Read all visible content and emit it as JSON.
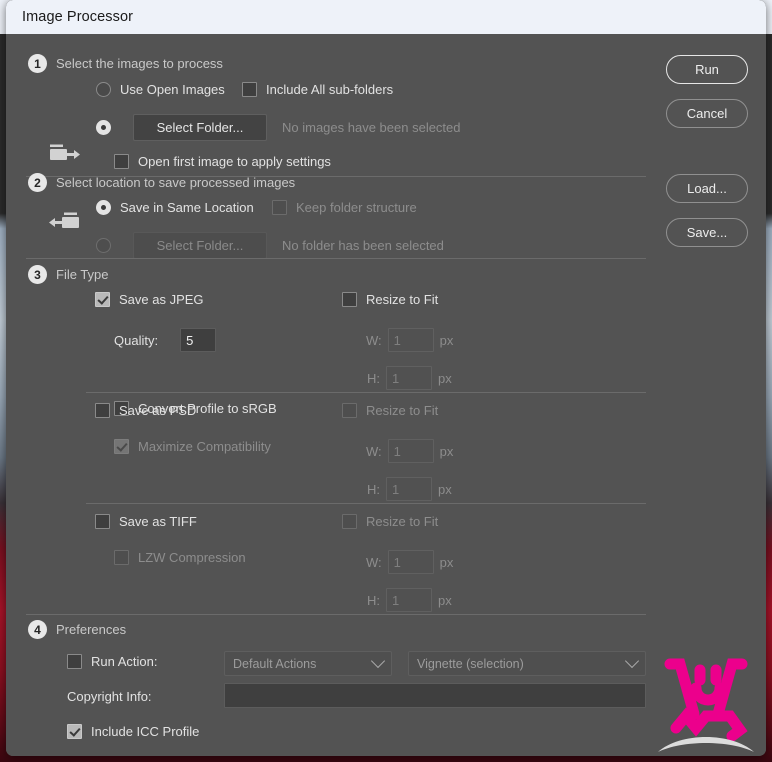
{
  "window": {
    "title": "Image Processor"
  },
  "sections": [
    {
      "number": "1",
      "title": "Select the images to process",
      "use_open_images_label": "Use Open Images",
      "include_subfolders_label": "Include All sub-folders",
      "select_folder_label": "Select Folder...",
      "folder_status": "No images have been selected",
      "open_first_image_label": "Open first image to apply settings",
      "source_icon": "folder-in-icon"
    },
    {
      "number": "2",
      "title": "Select location to save processed images",
      "save_same_location_label": "Save in Same Location",
      "keep_folder_structure_label": "Keep folder structure",
      "select_folder_label": "Select Folder...",
      "folder_status": "No folder has been selected",
      "dest_icon": "folder-out-icon"
    },
    {
      "number": "3",
      "title": "File Type"
    },
    {
      "number": "4",
      "title": "Preferences"
    }
  ],
  "file_type": {
    "jpeg": {
      "save_label": "Save as JPEG",
      "quality_label": "Quality:",
      "quality_value": "5",
      "convert_srgb_label": "Convert Profile to sRGB",
      "resize_label": "Resize to Fit",
      "w_label": "W:",
      "w_value": "1",
      "h_label": "H:",
      "h_value": "1",
      "unit": "px"
    },
    "psd": {
      "save_label": "Save as PSD",
      "maximize_compat_label": "Maximize Compatibility",
      "resize_label": "Resize to Fit",
      "w_label": "W:",
      "w_value": "1",
      "h_label": "H:",
      "h_value": "1",
      "unit": "px"
    },
    "tiff": {
      "save_label": "Save as TIFF",
      "lzw_label": "LZW Compression",
      "resize_label": "Resize to Fit",
      "w_label": "W:",
      "w_value": "1",
      "h_label": "H:",
      "h_value": "1",
      "unit": "px"
    }
  },
  "preferences": {
    "run_action_label": "Run Action:",
    "action_set_value": "Default Actions",
    "action_value": "Vignette (selection)",
    "copyright_label": "Copyright Info:",
    "copyright_value": "",
    "include_icc_label": "Include ICC Profile"
  },
  "buttons": {
    "run": "Run",
    "cancel": "Cancel",
    "load": "Load...",
    "save": "Save..."
  },
  "colors": {
    "dialog_bg": "#535353",
    "titlebar_bg": "#eef2f9",
    "accent_pink": "#ec008c",
    "text": "#e2e2e2",
    "text_dim": "#8d8d8d"
  }
}
